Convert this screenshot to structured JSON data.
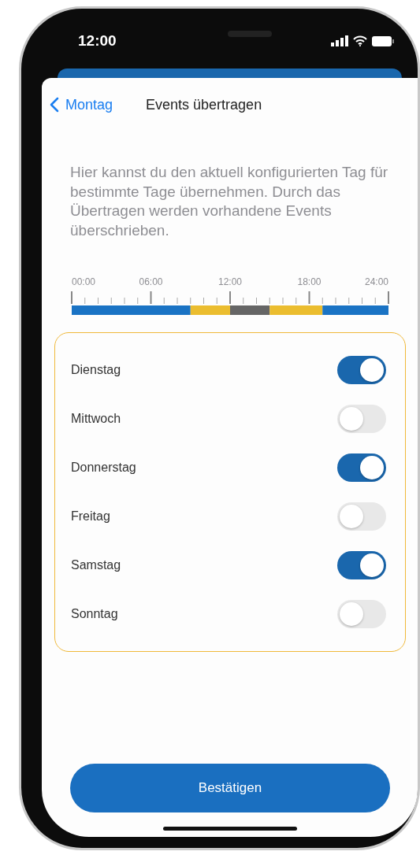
{
  "status_bar": {
    "time": "12:00"
  },
  "nav": {
    "back": "Montag",
    "title": "Events übertragen"
  },
  "description": "Hier kannst du den aktuell konfigurierten Tag für bestimmte Tage übernehmen. Durch das Übertragen werden vorhandene Events überschrieben.",
  "timeline": {
    "chart_data": {
      "type": "bar",
      "orientation": "horizontal",
      "stacked": true,
      "grid": true,
      "xlim": [
        0,
        24
      ],
      "xticks": [
        {
          "value": 0,
          "label": "00:00"
        },
        {
          "value": 6,
          "label": "06:00"
        },
        {
          "value": 12,
          "label": "12:00"
        },
        {
          "value": 18,
          "label": "18:00"
        },
        {
          "value": 24,
          "label": "24:00"
        }
      ],
      "series": [
        {
          "color": "#1a73c4",
          "values": [
            9
          ]
        },
        {
          "color": "#ebbd2f",
          "values": [
            3
          ]
        },
        {
          "color": "#666666",
          "values": [
            3
          ]
        },
        {
          "color": "#ebbd2f",
          "values": [
            4
          ]
        },
        {
          "color": "#1a73c4",
          "values": [
            5
          ]
        }
      ]
    }
  },
  "days": [
    {
      "label": "Dienstag",
      "on": true
    },
    {
      "label": "Mittwoch",
      "on": false
    },
    {
      "label": "Donnerstag",
      "on": true
    },
    {
      "label": "Freitag",
      "on": false
    },
    {
      "label": "Samstag",
      "on": true
    },
    {
      "label": "Sonntag",
      "on": false
    }
  ],
  "confirm_button": "Bestätigen"
}
